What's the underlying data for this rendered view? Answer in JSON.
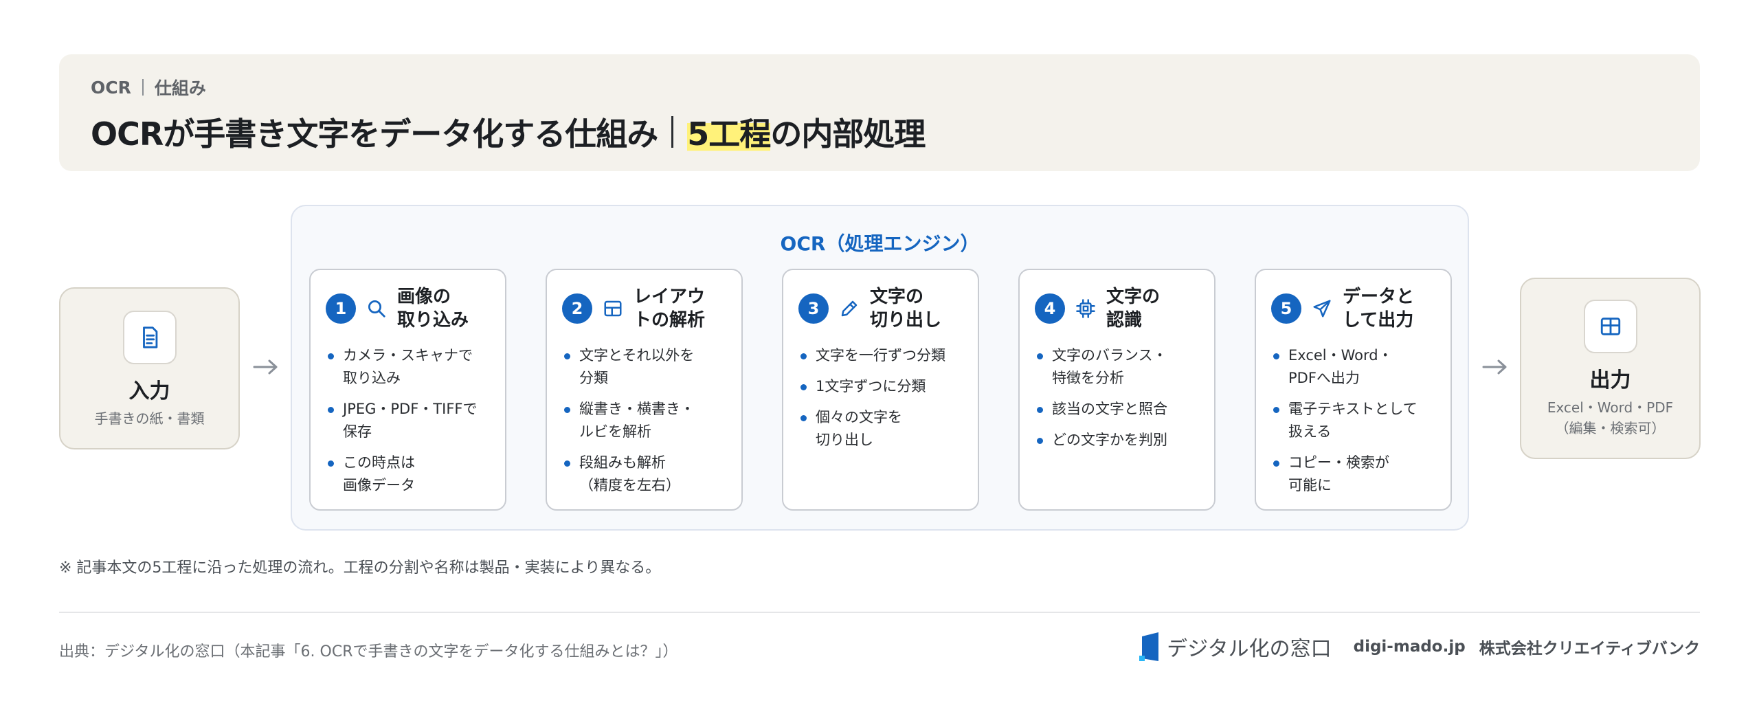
{
  "header": {
    "breadcrumb": [
      "OCR",
      "仕組み"
    ],
    "title_main": "OCRが手書き文字をデータ化する仕組み",
    "title_highlight": "5工程",
    "title_tail": "の内部処理"
  },
  "input": {
    "icon": "document-icon",
    "title": "入力",
    "subtitle": "手書きの紙・書類"
  },
  "engine": {
    "title": "OCR（処理エンジン）",
    "steps": [
      {
        "number": "1",
        "icon": "search-icon",
        "title": "画像の\n取り込み",
        "bullets": [
          "カメラ・スキャナで\n取り込み",
          "JPEG・PDF・TIFFで\n保存",
          "この時点は\n画像データ"
        ]
      },
      {
        "number": "2",
        "icon": "layout-grid-icon",
        "title": "レイアウ\nトの解析",
        "bullets": [
          "文字とそれ以外を\n分類",
          "縦書き・横書き・\nルビを解析",
          "段組みも解析\n（精度を左右）"
        ]
      },
      {
        "number": "3",
        "icon": "pencil-icon",
        "title": "文字の\n切り出し",
        "bullets": [
          "文字を一行ずつ分類",
          "1文字ずつに分類",
          "個々の文字を\n切り出し"
        ]
      },
      {
        "number": "4",
        "icon": "chip-icon",
        "title": "文字の\n認識",
        "bullets": [
          "文字のバランス・\n特徴を分析",
          "該当の文字と照合",
          "どの文字かを判別"
        ]
      },
      {
        "number": "5",
        "icon": "send-icon",
        "title": "データと\nして出力",
        "bullets": [
          "Excel・Word・\nPDFへ出力",
          "電子テキストとして\n扱える",
          "コピー・検索が\n可能に"
        ]
      }
    ]
  },
  "output": {
    "icon": "table-icon",
    "title": "出力",
    "subtitle": "Excel・Word・PDF\n（編集・検索可）"
  },
  "note": "※ 記事本文の5工程に沿った処理の流れ。工程の分割や名称は製品・実装により異なる。",
  "footer": {
    "source": "出典：デジタル化の窓口（本記事「6. OCRで手書きの文字をデータ化する仕組みとは？」）",
    "brand_name": "デジタル化の窓口",
    "domain": "digi-mado.jp",
    "company": "株式会社クリエイティブバンク"
  },
  "colors": {
    "accent": "#1565c0",
    "panel": "#f4f2ec",
    "highlight": "#fff27a"
  }
}
